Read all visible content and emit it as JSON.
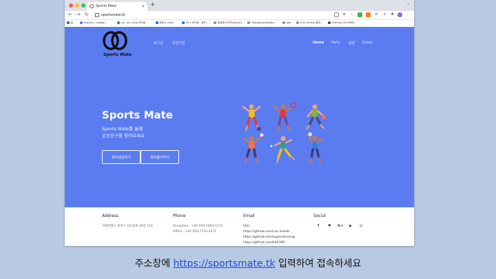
{
  "browser": {
    "tab_title": "Sports Mate",
    "url": "sportsmate.tk",
    "bookmarks": [
      "앱",
      "Practice | codegri...",
      "var, let, const 차이점",
      "한림 e-class",
      "03-1 문자형 : 점프...",
      "로컬에서 도커(docker)...",
      "\"Database/Databa...",
      "pog",
      "[Git] GitHub 협업...",
      "[GitHub] Git 브랜치..."
    ]
  },
  "site": {
    "logo_text": "Sports Mate",
    "auth": {
      "login": "로그인",
      "signup": "회원가입"
    },
    "menu": [
      {
        "label": "Home",
        "active": true
      },
      {
        "label": "Party",
        "active": false
      },
      {
        "label": "광장",
        "active": false
      },
      {
        "label": "Guide",
        "active": false
      }
    ],
    "hero": {
      "title": "Sports Mate",
      "subtitle_line1": "Sports Mate를 통해",
      "subtitle_line2": "운동친구를 찾아보세요",
      "button_create": "파티생성하기",
      "button_join": "파티참가하기"
    },
    "footer": {
      "address_title": "Address",
      "address_text": "서울특별시 성북구 삼선교로 16길 116",
      "phone_title": "Phone",
      "phone_reception": "Reception : +82 010-5693-5371",
      "phone_office": "Office : +82 010-7732-4471",
      "email_title": "Email",
      "email_site_label": "Site :",
      "email_link1": "https://github.com/ran-3roads",
      "email_link2": "https://github.com/superdevsong",
      "email_link3": "https://github.com/kdh789",
      "social_title": "Social",
      "social_icons": [
        "facebook-icon",
        "twitter-icon",
        "google-plus-icon",
        "youtube-icon",
        "instagram-icon"
      ]
    }
  },
  "caption": {
    "prefix": "주소창에 ",
    "link": "https://sportsmate.tk",
    "suffix": " 입력하여 접속하세요"
  },
  "colors": {
    "hero_bg": "#5b7cf0",
    "page_bg": "#b8c9e3",
    "caption_link": "#1a4fd8"
  }
}
